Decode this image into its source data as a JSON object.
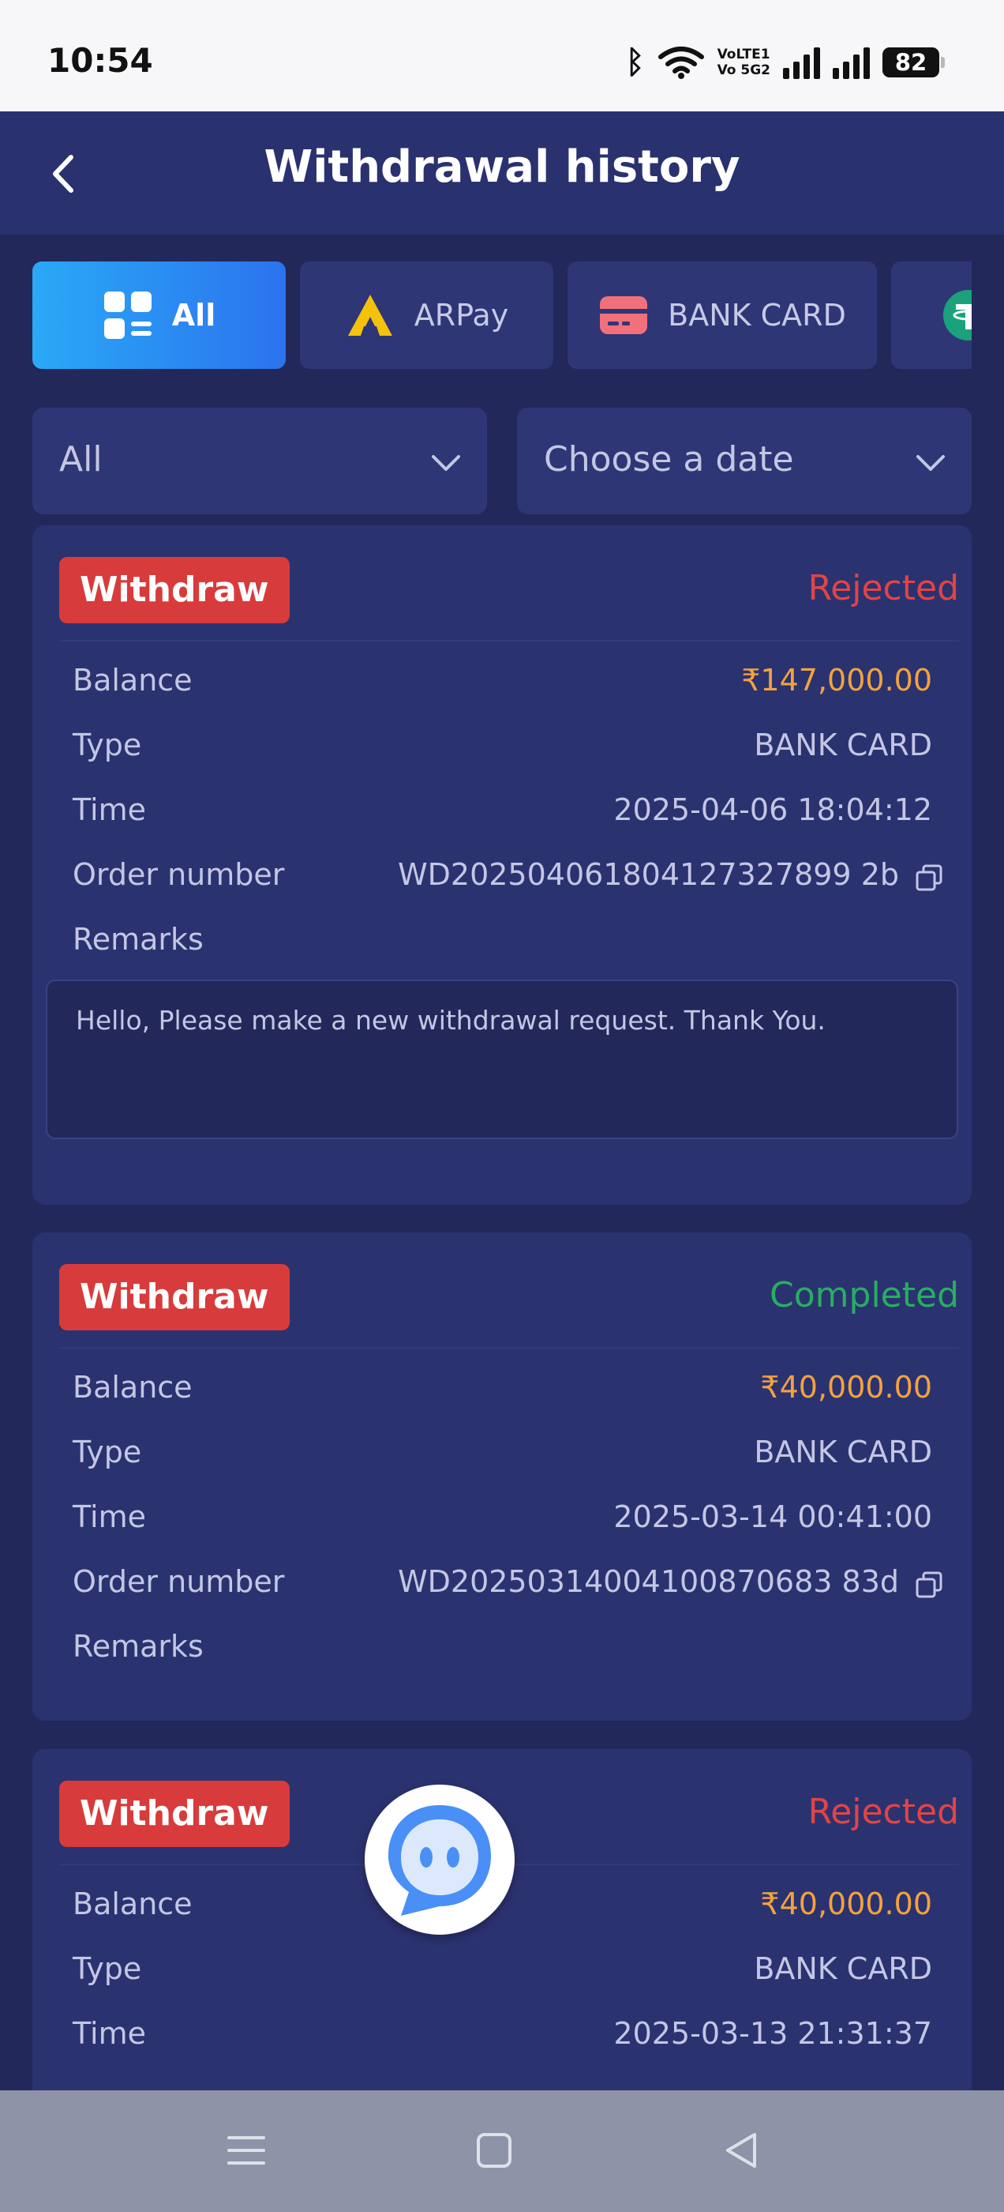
{
  "status_bar": {
    "time": "10:54",
    "volte_top": "VoLTE1",
    "volte_bottom": "Vo 5G2",
    "battery": "82"
  },
  "header": {
    "title": "Withdrawal history"
  },
  "tabs": [
    {
      "label": "All",
      "icon": "grid-icon",
      "active": true
    },
    {
      "label": "ARPay",
      "icon": "arpay-logo-icon",
      "active": false
    },
    {
      "label": "BANK CARD",
      "icon": "bank-card-icon",
      "active": false
    },
    {
      "label": "",
      "icon": "usdt-icon",
      "active": false
    }
  ],
  "filters": {
    "status": {
      "value": "All"
    },
    "date": {
      "placeholder": "Choose a date"
    }
  },
  "labels": {
    "balance": "Balance",
    "type": "Type",
    "time": "Time",
    "order_number": "Order number",
    "remarks": "Remarks"
  },
  "records": [
    {
      "badge": "Withdraw",
      "status": "Rejected",
      "status_color": "#e04545",
      "balance": "₹147,000.00",
      "type": "BANK CARD",
      "time": "2025-04-06 18:04:12",
      "order_number": "WD202504061804127327899 2b",
      "remark": "Hello, Please make a new withdrawal request. Thank You."
    },
    {
      "badge": "Withdraw",
      "status": "Completed",
      "status_color": "#27ae60",
      "balance": "₹40,000.00",
      "type": "BANK CARD",
      "time": "2025-03-14 00:41:00",
      "order_number": "WD20250314004100870683 83d",
      "remark": ""
    },
    {
      "badge": "Withdraw",
      "status": "Rejected",
      "status_color": "#e04545",
      "balance": "₹40,000.00",
      "type": "BANK CARD",
      "time": "2025-03-13 21:31:37",
      "order_number": "",
      "remark": ""
    }
  ],
  "colors": {
    "background": "#22285a",
    "card": "#2b3270",
    "accent": "#2b8af2",
    "badge": "#d83b3b",
    "amount": "#f2a23e"
  }
}
